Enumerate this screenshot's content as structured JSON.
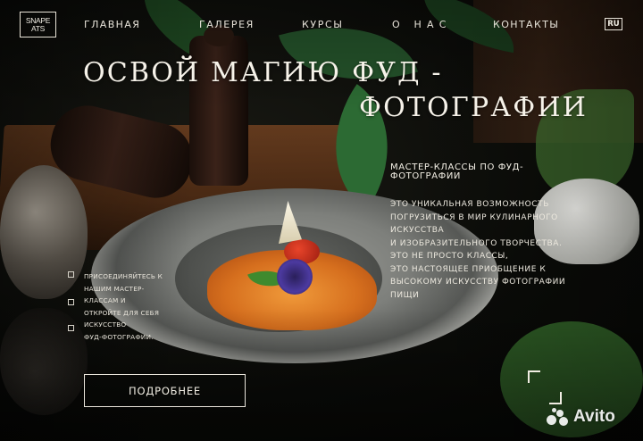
{
  "logo": {
    "line1": "SNAPE",
    "line2": "ATS"
  },
  "nav": {
    "items": [
      "ГЛАВНАЯ",
      "ГАЛЕРЕЯ",
      "КУРСЫ",
      "О НАС",
      "КОНТАКТЫ"
    ],
    "language": "RU"
  },
  "hero": {
    "title_line1": "ОСВОЙ МАГИЮ ФУД -",
    "title_line2": "ФОТОГРАФИИ",
    "subtitle": "МАСТЕР-КЛАССЫ ПО ФУД-ФОТОГРАФИИ",
    "description_lines": [
      "ЭТО УНИКАЛЬНАЯ ВОЗМОЖНОСТЬ",
      "ПОГРУЗИТЬСЯ В МИР КУЛИНАРНОГО",
      "ИСКУССТВА",
      "И ИЗОБРАЗИТЕЛЬНОГО ТВОРЧЕСТВА.",
      "ЭТО НЕ ПРОСТО КЛАССЫ,",
      "ЭТО НАСТОЯЩЕЕ ПРИОБЩЕНИЕ К",
      "ВЫСОКОМУ ИСКУССТВУ ФОТОГРАФИИ",
      "ПИЩИ"
    ],
    "side_text_lines": [
      "ПРИСОЕДИНЯЙТЕСЬ К",
      "НАШИМ МАСТЕР-",
      "КЛАССАМ И",
      "ОТКРОЙТЕ ДЛЯ СЕБЯ",
      "ИСКУССТВО",
      "ФУД-ФОТОГРАФИИ."
    ],
    "cta_label": "ПОДРОБНЕЕ"
  },
  "slider": {
    "dot_count": 3
  },
  "watermark": {
    "text": "Avito"
  },
  "colors": {
    "text": "#f2efe8",
    "background": "#0b0c0a",
    "accent_wood": "#4d2a13"
  }
}
